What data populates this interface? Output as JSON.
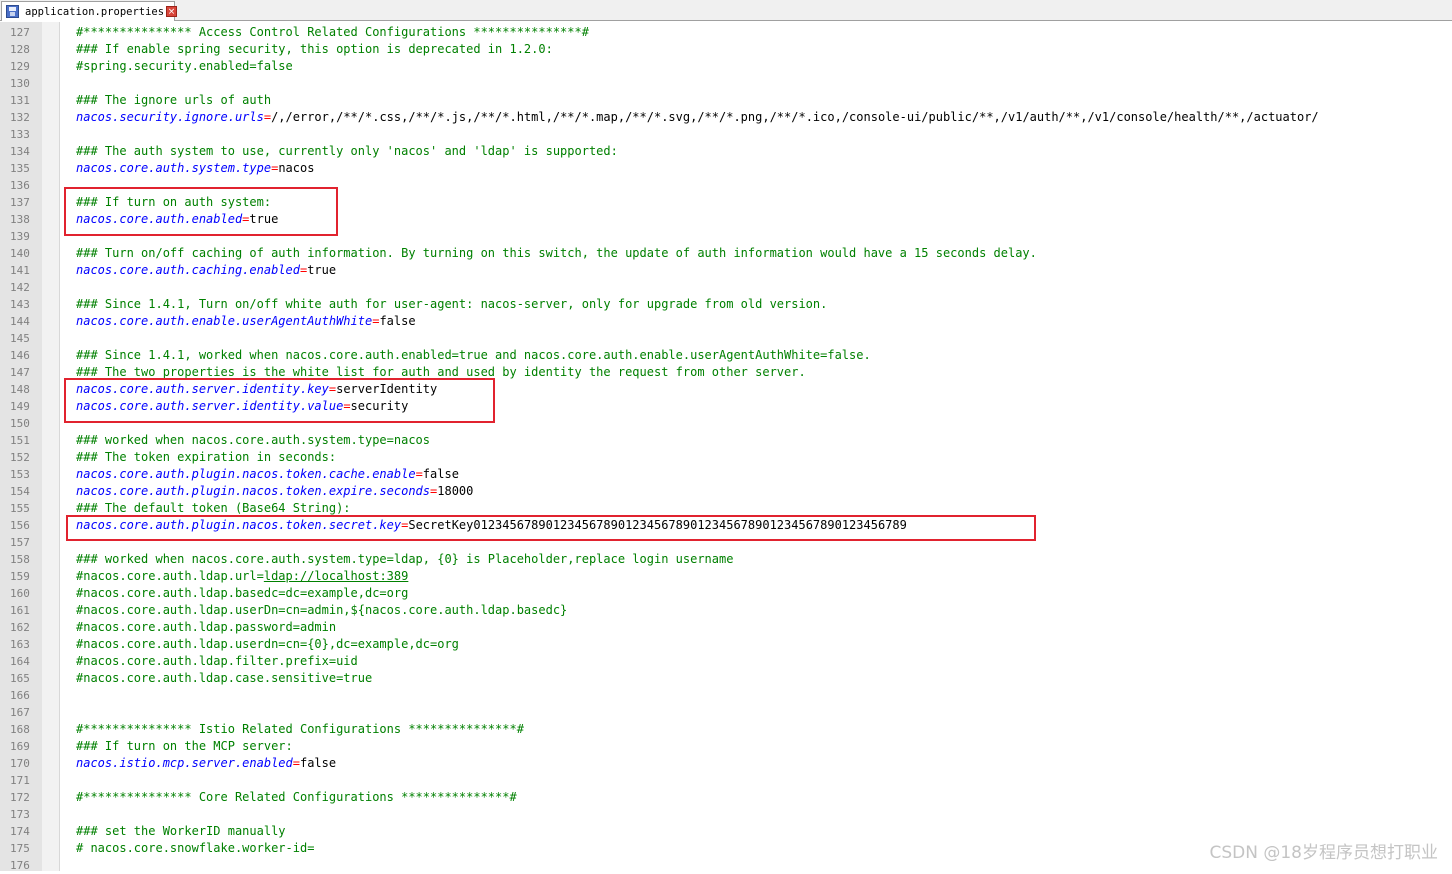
{
  "tab": {
    "filename": "application.properties",
    "close_glyph": "×"
  },
  "watermark": "CSDN @18岁程序员想打职业",
  "colors": {
    "comment": "#008000",
    "key": "#0000ff",
    "equals": "#ff0000",
    "value": "#000000",
    "highlight_box": "#e1232f"
  },
  "lines": [
    {
      "n": "127",
      "parts": [
        {
          "t": "c",
          "s": "#*************** Access Control Related Configurations ***************#"
        }
      ]
    },
    {
      "n": "128",
      "parts": [
        {
          "t": "c",
          "s": "### If enable spring security, this option is deprecated in 1.2.0:"
        }
      ]
    },
    {
      "n": "129",
      "parts": [
        {
          "t": "c",
          "s": "#spring.security.enabled=false"
        }
      ]
    },
    {
      "n": "130",
      "parts": []
    },
    {
      "n": "131",
      "parts": [
        {
          "t": "c",
          "s": "### The ignore urls of auth"
        }
      ]
    },
    {
      "n": "132",
      "parts": [
        {
          "t": "k",
          "s": "nacos.security.ignore.urls"
        },
        {
          "t": "eq",
          "s": "="
        },
        {
          "t": "v",
          "s": "/,/error,/**/*.css,/**/*.js,/**/*.html,/**/*.map,/**/*.svg,/**/*.png,/**/*.ico,/console-ui/public/**,/v1/auth/**,/v1/console/health/**,/actuator/"
        }
      ]
    },
    {
      "n": "133",
      "parts": []
    },
    {
      "n": "134",
      "parts": [
        {
          "t": "c",
          "s": "### The auth system to use, currently only 'nacos' and 'ldap' is supported:"
        }
      ]
    },
    {
      "n": "135",
      "parts": [
        {
          "t": "k",
          "s": "nacos.core.auth.system.type"
        },
        {
          "t": "eq",
          "s": "="
        },
        {
          "t": "v",
          "s": "nacos"
        }
      ]
    },
    {
      "n": "136",
      "parts": []
    },
    {
      "n": "137",
      "parts": [
        {
          "t": "c",
          "s": "### If turn on auth system:"
        }
      ]
    },
    {
      "n": "138",
      "parts": [
        {
          "t": "k",
          "s": "nacos.core.auth.enabled"
        },
        {
          "t": "eq",
          "s": "="
        },
        {
          "t": "v",
          "s": "true"
        }
      ]
    },
    {
      "n": "139",
      "parts": []
    },
    {
      "n": "140",
      "parts": [
        {
          "t": "c",
          "s": "### Turn on/off caching of auth information. By turning on this switch, the update of auth information would have a 15 seconds delay."
        }
      ]
    },
    {
      "n": "141",
      "parts": [
        {
          "t": "k",
          "s": "nacos.core.auth.caching.enabled"
        },
        {
          "t": "eq",
          "s": "="
        },
        {
          "t": "v",
          "s": "true"
        }
      ]
    },
    {
      "n": "142",
      "parts": []
    },
    {
      "n": "143",
      "parts": [
        {
          "t": "c",
          "s": "### Since 1.4.1, Turn on/off white auth for user-agent: nacos-server, only for upgrade from old version."
        }
      ]
    },
    {
      "n": "144",
      "parts": [
        {
          "t": "k",
          "s": "nacos.core.auth.enable.userAgentAuthWhite"
        },
        {
          "t": "eq",
          "s": "="
        },
        {
          "t": "v",
          "s": "false"
        }
      ]
    },
    {
      "n": "145",
      "parts": []
    },
    {
      "n": "146",
      "parts": [
        {
          "t": "c",
          "s": "### Since 1.4.1, worked when nacos.core.auth.enabled=true and nacos.core.auth.enable.userAgentAuthWhite=false."
        }
      ]
    },
    {
      "n": "147",
      "parts": [
        {
          "t": "c",
          "s": "### The two properties is the white list for auth and used by identity the request from other server."
        }
      ]
    },
    {
      "n": "148",
      "parts": [
        {
          "t": "k",
          "s": "nacos.core.auth.server.identity.key"
        },
        {
          "t": "eq",
          "s": "="
        },
        {
          "t": "v",
          "s": "serverIdentity"
        }
      ]
    },
    {
      "n": "149",
      "parts": [
        {
          "t": "k",
          "s": "nacos.core.auth.server.identity.value"
        },
        {
          "t": "eq",
          "s": "="
        },
        {
          "t": "v",
          "s": "security"
        }
      ]
    },
    {
      "n": "150",
      "parts": []
    },
    {
      "n": "151",
      "parts": [
        {
          "t": "c",
          "s": "### worked when nacos.core.auth.system.type=nacos"
        }
      ]
    },
    {
      "n": "152",
      "parts": [
        {
          "t": "c",
          "s": "### The token expiration in seconds:"
        }
      ]
    },
    {
      "n": "153",
      "parts": [
        {
          "t": "k",
          "s": "nacos.core.auth.plugin.nacos.token.cache.enable"
        },
        {
          "t": "eq",
          "s": "="
        },
        {
          "t": "v",
          "s": "false"
        }
      ]
    },
    {
      "n": "154",
      "parts": [
        {
          "t": "k",
          "s": "nacos.core.auth.plugin.nacos.token.expire.seconds"
        },
        {
          "t": "eq",
          "s": "="
        },
        {
          "t": "v",
          "s": "18000"
        }
      ]
    },
    {
      "n": "155",
      "parts": [
        {
          "t": "c",
          "s": "### The default token (Base64 String):"
        }
      ]
    },
    {
      "n": "156",
      "parts": [
        {
          "t": "k",
          "s": "nacos.core.auth.plugin.nacos.token.secret.key"
        },
        {
          "t": "eq",
          "s": "="
        },
        {
          "t": "v",
          "s": "SecretKey012345678901234567890123456789012345678901234567890123456789"
        }
      ]
    },
    {
      "n": "157",
      "parts": []
    },
    {
      "n": "158",
      "parts": [
        {
          "t": "c",
          "s": "### worked when nacos.core.auth.system.type=ldap, {0} is Placeholder,replace login username"
        }
      ]
    },
    {
      "n": "159",
      "parts": [
        {
          "t": "c",
          "s": "#nacos.core.auth.ldap.url="
        },
        {
          "t": "c link",
          "s": "ldap://localhost:389"
        }
      ]
    },
    {
      "n": "160",
      "parts": [
        {
          "t": "c",
          "s": "#nacos.core.auth.ldap.basedc=dc=example,dc=org"
        }
      ]
    },
    {
      "n": "161",
      "parts": [
        {
          "t": "c",
          "s": "#nacos.core.auth.ldap.userDn=cn=admin,${nacos.core.auth.ldap.basedc}"
        }
      ]
    },
    {
      "n": "162",
      "parts": [
        {
          "t": "c",
          "s": "#nacos.core.auth.ldap.password=admin"
        }
      ]
    },
    {
      "n": "163",
      "parts": [
        {
          "t": "c",
          "s": "#nacos.core.auth.ldap.userdn=cn={0},dc=example,dc=org"
        }
      ]
    },
    {
      "n": "164",
      "parts": [
        {
          "t": "c",
          "s": "#nacos.core.auth.ldap.filter.prefix=uid"
        }
      ]
    },
    {
      "n": "165",
      "parts": [
        {
          "t": "c",
          "s": "#nacos.core.auth.ldap.case.sensitive=true"
        }
      ]
    },
    {
      "n": "166",
      "parts": []
    },
    {
      "n": "167",
      "parts": []
    },
    {
      "n": "168",
      "parts": [
        {
          "t": "c",
          "s": "#*************** Istio Related Configurations ***************#"
        }
      ]
    },
    {
      "n": "169",
      "parts": [
        {
          "t": "c",
          "s": "### If turn on the MCP server:"
        }
      ]
    },
    {
      "n": "170",
      "parts": [
        {
          "t": "k",
          "s": "nacos.istio.mcp.server.enabled"
        },
        {
          "t": "eq",
          "s": "="
        },
        {
          "t": "v",
          "s": "false"
        }
      ]
    },
    {
      "n": "171",
      "parts": []
    },
    {
      "n": "172",
      "parts": [
        {
          "t": "c",
          "s": "#*************** Core Related Configurations ***************#"
        }
      ]
    },
    {
      "n": "173",
      "parts": []
    },
    {
      "n": "174",
      "parts": [
        {
          "t": "c",
          "s": "### set the WorkerID manually"
        }
      ]
    },
    {
      "n": "175",
      "parts": [
        {
          "t": "c",
          "s": "# nacos.core.snowflake.worker-id="
        }
      ]
    },
    {
      "n": "176",
      "parts": []
    }
  ]
}
